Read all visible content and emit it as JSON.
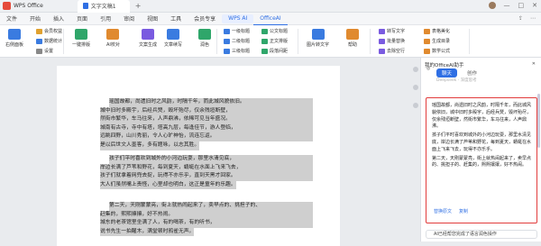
{
  "window": {
    "app_name": "WPS Office",
    "doc_tab": "文字文稿1",
    "add_tab": "+"
  },
  "menu": {
    "items": [
      "文件",
      "开始",
      "插入",
      "页面",
      "引用",
      "审阅",
      "视图",
      "工具",
      "会员专享",
      "WPS AI",
      "OfficeAI"
    ],
    "active": "OfficeAI"
  },
  "ribbon": {
    "large": [
      {
        "label": "右侧面板",
        "color": "#3a7be0"
      },
      {
        "label": "一键排版",
        "color": "#2fa66a"
      },
      {
        "label": "AI校对",
        "color": "#e08a2f"
      },
      {
        "label": "文案生成",
        "color": "#7a5be0"
      },
      {
        "label": "文章续写",
        "color": "#3a7be0"
      },
      {
        "label": "润色",
        "color": "#2fa66a"
      },
      {
        "label": "图片转文字",
        "color": "#3a7be0"
      },
      {
        "label": "帮助",
        "color": "#e08a2f"
      }
    ],
    "small": [
      {
        "label": "会员权益",
        "color": "#e0a12f"
      },
      {
        "label": "数据统计",
        "color": "#3a7be0"
      },
      {
        "label": "设置",
        "color": "#888"
      },
      {
        "label": "一级标题",
        "color": "#3a7be0"
      },
      {
        "label": "二级标题",
        "color": "#3a7be0"
      },
      {
        "label": "三级标题",
        "color": "#3a7be0"
      },
      {
        "label": "公文标题",
        "color": "#2fa66a"
      },
      {
        "label": "正文排版",
        "color": "#2fa66a"
      },
      {
        "label": "段落间距",
        "color": "#2fa66a"
      },
      {
        "label": "转写文字",
        "color": "#7a5be0"
      },
      {
        "label": "批量替换",
        "color": "#7a5be0"
      },
      {
        "label": "去除空行",
        "color": "#7a5be0"
      },
      {
        "label": "表格美化",
        "color": "#e08a2f"
      },
      {
        "label": "生成目录",
        "color": "#e08a2f"
      },
      {
        "label": "数学公式",
        "color": "#e08a2f"
      }
    ]
  },
  "document": {
    "paragraphs": [
      [
        "瑶国故都，尚遗旧时之风韵，时隔千年，而此城风貌依旧。",
        "城中旧时多殿宇，后经兵燹，毁坏殆尽，仅余残垣断壁，",
        "然街市繁华，车马往来，人声鼎沸，依稀可见当年盛况。",
        "城南有古寺，寺中有塔，塔高九层，每逢佳节，游人登临，",
        "远眺四野，山川秀丽，令人心旷神怡，流连忘返。",
        "是以后世文人墨客，多有题咏，以志其胜。"
      ],
      [
        "孩子们平时喜欢到城外的小河边玩耍，那里水清见底，",
        "岸边长满了芦苇和野花，每到夏天，蜻蜓在水面上飞来飞去，",
        "孩子们就拿着网兜去捉，玩得不亦乐乎，直到天黑才回家。",
        "大人们虽然嘴上责怪，心里却也明白，这正是童年的乐趣。"
      ],
      [
        "第二天，天刚蒙蒙亮，街上就热闹起来了，卖早点的、挑担子的、",
        "赶集的，熙熙攘攘，好不热闹。",
        "城东的老茶馆里坐满了人，有的喝茶，有的听书，",
        "说书先生一拍醒木，满堂顿时鸦雀无声。"
      ]
    ]
  },
  "panel": {
    "title": "我的OfficeAI助手",
    "tabs": [
      "聊天",
      "创作"
    ],
    "active_tab": "聊天",
    "sub": "Deepseek · 深度思考",
    "output": [
      "瑶国故都，尚遗旧时之风韵，时隔千年，而此城风貌依旧，城中旧时多殿宇，后经兵燹，毁坏殆尽，仅余残垣断壁，然街市繁华，车马往来，人声鼎沸。",
      "孩子们平时喜欢到城外的小河边玩耍，那里水清见底，岸边长满了芦苇和野花，每到夏天，蜻蜓在水面上飞来飞去，玩得不亦乐乎。",
      "第二天，天刚蒙蒙亮，街上就热闹起来了，卖早点的、挑担子的、赶集的，熙熙攘攘，好不热闹。"
    ],
    "actions": [
      "替换原文",
      "复制"
    ],
    "prompt": "AI已经帮您完成了语言润色操作"
  }
}
